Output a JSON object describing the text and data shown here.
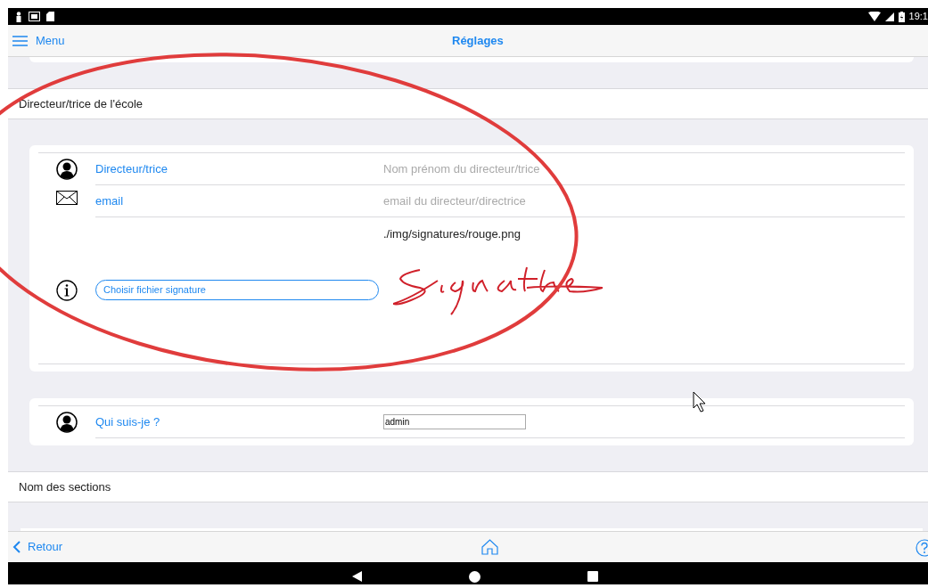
{
  "status_bar": {
    "time": "19:1"
  },
  "nav_bar": {
    "menu_label": "Menu",
    "title": "Réglages"
  },
  "director_section": {
    "header": "Directeur/trice de l'école",
    "rows": [
      {
        "kind": "name",
        "label": "Directeur/trice",
        "placeholder": "Nom prénom du directeur/trice"
      },
      {
        "kind": "email",
        "label": "email",
        "placeholder": "email du directeur/directrice"
      },
      {
        "kind": "signature",
        "path": "./img/signatures/rouge.png",
        "button": "Choisir fichier signature"
      }
    ]
  },
  "identity_card": {
    "rows": [
      {
        "kind": "identity",
        "label": "Qui suis-je ?",
        "value": "admin"
      }
    ]
  },
  "sections_header": "Nom des sections",
  "bottom_bar": {
    "back_label": "Retour"
  }
}
